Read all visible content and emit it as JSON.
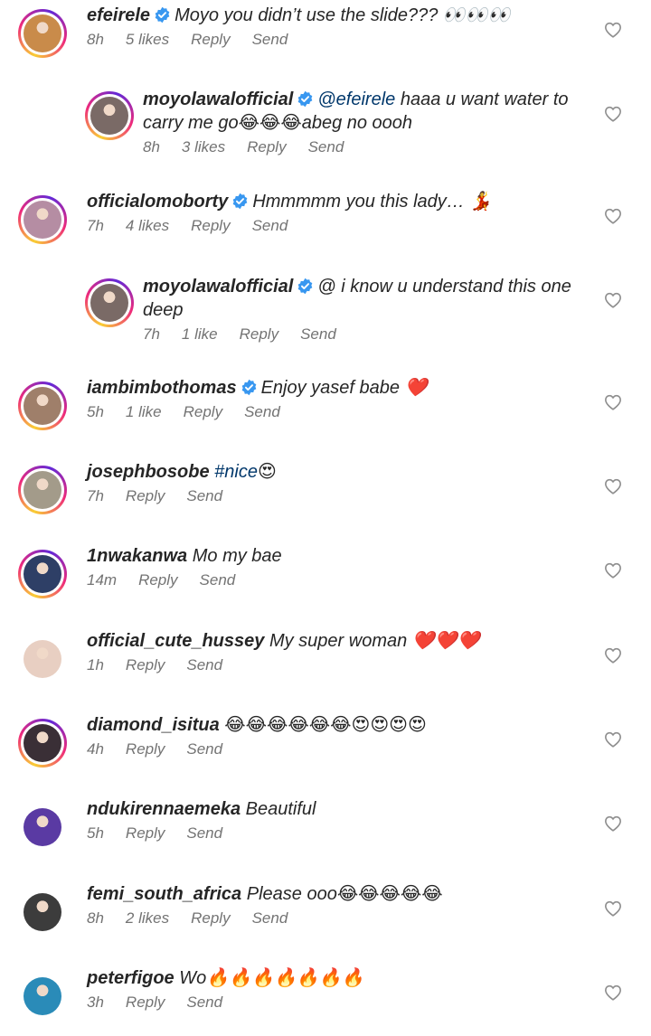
{
  "comments": [
    {
      "username": "efeirele",
      "verified": true,
      "text": "Moyo you didn’t use the slide??? 👀👀👀",
      "time": "8h",
      "likes": "5 likes",
      "reply": "Reply",
      "send": "Send",
      "reply_level": 0,
      "avatar_ring": "story",
      "avatar_color": "#c98b4a"
    },
    {
      "username": "moyolawalofficial",
      "verified": true,
      "mention": "@efeirele",
      "text": " haaa u want water to carry me go😂😂😂abeg no oooh",
      "time": "8h",
      "likes": "3 likes",
      "reply": "Reply",
      "send": "Send",
      "reply_level": 1,
      "avatar_ring": "story",
      "avatar_color": "#7a6a66"
    },
    {
      "username": "officialomoborty",
      "verified": true,
      "text": "Hmmmmm you this lady… 💃",
      "time": "7h",
      "likes": "4 likes",
      "reply": "Reply",
      "send": "Send",
      "reply_level": 0,
      "avatar_ring": "story",
      "avatar_color": "#b58da3"
    },
    {
      "username": "moyolawalofficial",
      "verified": true,
      "text": "@ i know u understand this one deep",
      "time": "7h",
      "likes": "1 like",
      "reply": "Reply",
      "send": "Send",
      "reply_level": 1,
      "avatar_ring": "story",
      "avatar_color": "#7a6a66"
    },
    {
      "username": "iambimbothomas",
      "verified": true,
      "text": "Enjoy yasef babe ❤️",
      "time": "5h",
      "likes": "1 like",
      "reply": "Reply",
      "send": "Send",
      "reply_level": 0,
      "avatar_ring": "story",
      "avatar_color": "#9f7f6a"
    },
    {
      "username": "josephbosobe",
      "verified": false,
      "hashtag": "#nice",
      "text": "😍",
      "time": "7h",
      "likes": "",
      "reply": "Reply",
      "send": "Send",
      "reply_level": 0,
      "avatar_ring": "story",
      "avatar_color": "#a39b8a"
    },
    {
      "username": "1nwakanwa",
      "verified": false,
      "text": "Mo my bae",
      "time": "14m",
      "likes": "",
      "reply": "Reply",
      "send": "Send",
      "reply_level": 0,
      "avatar_ring": "story",
      "avatar_color": "#2e3f66"
    },
    {
      "username": "official_cute_hussey",
      "verified": false,
      "text": "My super woman ❤️❤️❤️",
      "time": "1h",
      "likes": "",
      "reply": "Reply",
      "send": "Send",
      "reply_level": 0,
      "avatar_ring": "plain",
      "avatar_color": "#e8cfc2"
    },
    {
      "username": "diamond_isitua",
      "verified": false,
      "text": "😂😂😂😂😂😂😍😍😍😍",
      "time": "4h",
      "likes": "",
      "reply": "Reply",
      "send": "Send",
      "reply_level": 0,
      "avatar_ring": "story",
      "avatar_color": "#3a2f36"
    },
    {
      "username": "ndukirennaemeka",
      "verified": false,
      "text": "Beautiful",
      "time": "5h",
      "likes": "",
      "reply": "Reply",
      "send": "Send",
      "reply_level": 0,
      "avatar_ring": "plain",
      "avatar_color": "#5a3aa3"
    },
    {
      "username": "femi_south_africa",
      "verified": false,
      "text": "Please ooo😂😂😂😂😂",
      "time": "8h",
      "likes": "2 likes",
      "reply": "Reply",
      "send": "Send",
      "reply_level": 0,
      "avatar_ring": "plain",
      "avatar_color": "#3c3c3c"
    },
    {
      "username": "peterfigoe",
      "verified": false,
      "text": "Wo🔥🔥🔥🔥🔥🔥🔥",
      "time": "3h",
      "likes": "",
      "reply": "Reply",
      "send": "Send",
      "reply_level": 0,
      "avatar_ring": "plain",
      "avatar_color": "#2a8bb8"
    }
  ],
  "colors": {
    "verified_badge": "#3897f0",
    "meta_text": "#737373",
    "link": "#00376b",
    "heart_outline": "#8e8e8e"
  },
  "icons": {
    "like": "heart-outline-icon",
    "verified": "verified-badge-icon"
  }
}
